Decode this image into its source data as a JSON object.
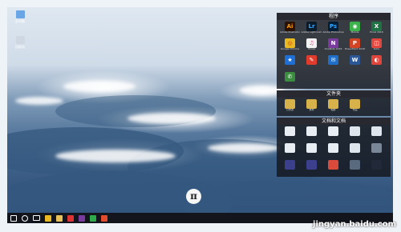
{
  "desktop_icons": [
    {
      "label": "此电脑",
      "icon": "computer-icon",
      "color": "#6aa6e6"
    },
    {
      "label": "回收站",
      "icon": "recycle-bin-icon",
      "color": "#cfd8e2"
    }
  ],
  "fences": [
    {
      "title": "程序",
      "items": [
        {
          "label": "Adobe Illustrator",
          "glyph": "Ai",
          "color": "#2b1200",
          "fg": "#ff9a00"
        },
        {
          "label": "Adobe Lightroom",
          "glyph": "Lr",
          "color": "#0b1b2a",
          "fg": "#31a8ff"
        },
        {
          "label": "Adobe Photoshop",
          "glyph": "Ps",
          "color": "#001e36",
          "fg": "#31a8ff"
        },
        {
          "label": "Mobile",
          "glyph": "◉",
          "color": "#3cb24a",
          "fg": "#fff"
        },
        {
          "label": "Excel 2016",
          "glyph": "X",
          "color": "#1f7244",
          "fg": "#fff"
        },
        {
          "label": "Google Chrome",
          "glyph": "◎",
          "color": "#e8b920",
          "fg": "#d8392b"
        },
        {
          "label": "iTunes",
          "glyph": "♫",
          "color": "#f2f2f2",
          "fg": "#e0457b"
        },
        {
          "label": "OneNote 2016",
          "glyph": "N",
          "color": "#7a3b9e",
          "fg": "#fff"
        },
        {
          "label": "PowerPoint 2016",
          "glyph": "P",
          "color": "#d14524",
          "fg": "#fff"
        },
        {
          "label": "Sohu",
          "glyph": "◫",
          "color": "#e2463c",
          "fg": "#fff"
        },
        {
          "label": "",
          "glyph": "★",
          "color": "#1d6fd6",
          "fg": "#fff"
        },
        {
          "label": "",
          "glyph": "✎",
          "color": "#e03c2e",
          "fg": "#fff"
        },
        {
          "label": "",
          "glyph": "✉",
          "color": "#1f6fc8",
          "fg": "#fff"
        },
        {
          "label": "",
          "glyph": "W",
          "color": "#2b5797",
          "fg": "#fff"
        },
        {
          "label": "",
          "glyph": "◐",
          "color": "#e0443b",
          "fg": "#fff"
        },
        {
          "label": "",
          "glyph": "✆",
          "color": "#3a8d3f",
          "fg": "#fff"
        }
      ]
    },
    {
      "title": "文件夹",
      "items": [
        {
          "label": "已修改",
          "glyph": "",
          "color": "#d7b14a",
          "fg": "#fff"
        },
        {
          "label": "素材",
          "glyph": "",
          "color": "#d7b14a",
          "fg": "#fff"
        },
        {
          "label": "相册",
          "glyph": "",
          "color": "#d7b14a",
          "fg": "#fff"
        },
        {
          "label": "作品",
          "glyph": "",
          "color": "#d7b14a",
          "fg": "#fff"
        }
      ]
    },
    {
      "title": "文档和文档",
      "items": [
        {
          "label": "",
          "glyph": "",
          "color": "#e8edf3",
          "fg": "#333"
        },
        {
          "label": "",
          "glyph": "",
          "color": "#e8edf3",
          "fg": "#333"
        },
        {
          "label": "",
          "glyph": "",
          "color": "#e8edf3",
          "fg": "#333"
        },
        {
          "label": "",
          "glyph": "",
          "color": "#dfe5ec",
          "fg": "#333"
        },
        {
          "label": "",
          "glyph": "",
          "color": "#dfe5ec",
          "fg": "#333"
        },
        {
          "label": "",
          "glyph": "",
          "color": "#e8edf3",
          "fg": "#333"
        },
        {
          "label": "",
          "glyph": "",
          "color": "#e8edf3",
          "fg": "#333"
        },
        {
          "label": "",
          "glyph": "",
          "color": "#e8edf3",
          "fg": "#333"
        },
        {
          "label": "",
          "glyph": "",
          "color": "#dfe5ec",
          "fg": "#333"
        },
        {
          "label": "",
          "glyph": "",
          "color": "#7a8799",
          "fg": "#fff"
        },
        {
          "label": "",
          "glyph": "",
          "color": "#3c3f8c",
          "fg": "#fff"
        },
        {
          "label": "",
          "glyph": "",
          "color": "#3c3f8c",
          "fg": "#fff"
        },
        {
          "label": "",
          "glyph": "",
          "color": "#d94a3a",
          "fg": "#fff"
        },
        {
          "label": "",
          "glyph": "",
          "color": "#5a6a7e",
          "fg": "#fff"
        },
        {
          "label": "",
          "glyph": "",
          "color": "#222a3a",
          "fg": "#fff"
        }
      ]
    }
  ],
  "pi_button": {
    "glyph": "π"
  },
  "taskbar": [
    {
      "name": "start-icon",
      "color": "#ffffff"
    },
    {
      "name": "search-icon",
      "color": "#ffffff"
    },
    {
      "name": "taskview-icon",
      "color": "#ffffff"
    },
    {
      "name": "chrome-icon",
      "color": "#e8b920"
    },
    {
      "name": "explorer-icon",
      "color": "#e8c15a"
    },
    {
      "name": "app-red-icon",
      "color": "#d33"
    },
    {
      "name": "onenote-icon",
      "color": "#7a3b9e"
    },
    {
      "name": "app-green-icon",
      "color": "#2faa4a"
    },
    {
      "name": "app-orange-icon",
      "color": "#e34b2f"
    }
  ],
  "watermark": "jingyan.baidu.com"
}
